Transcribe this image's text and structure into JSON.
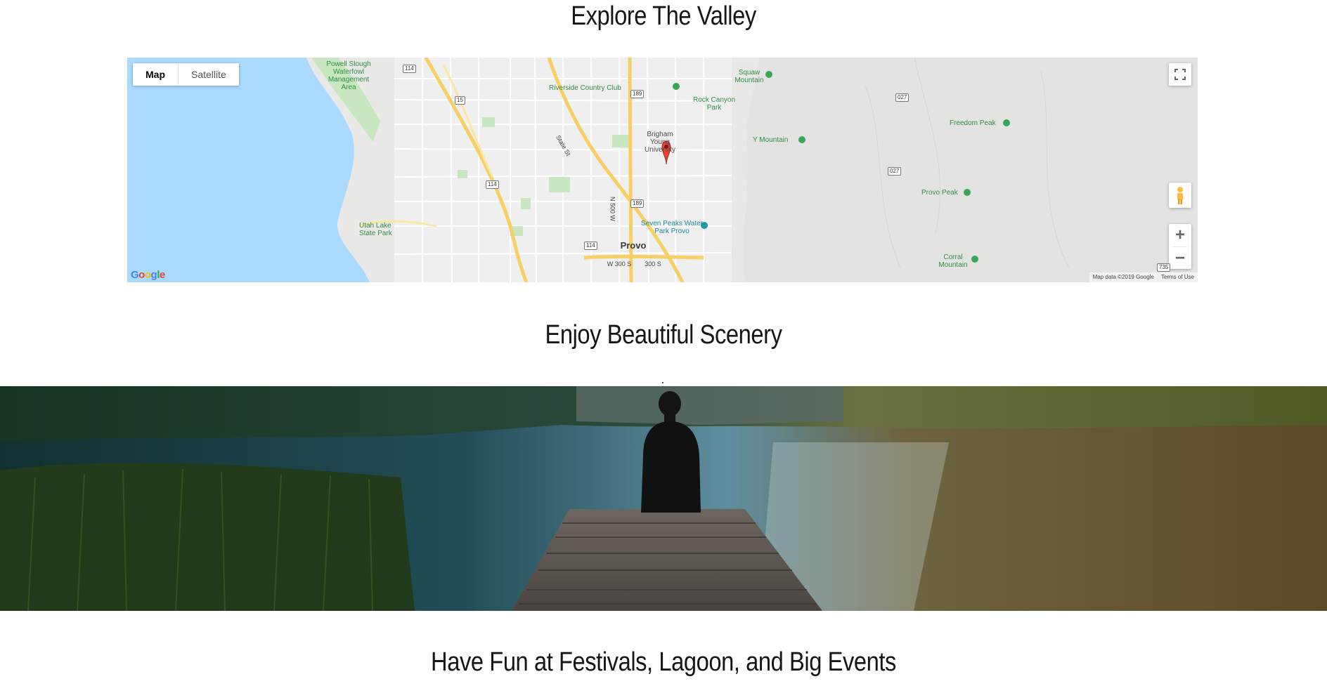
{
  "sections": {
    "explore_title": "Explore The Valley",
    "scenery_title": "Enjoy Beautiful Scenery",
    "fun_title": "Have Fun at Festivals, Lagoon, and Big Events"
  },
  "map": {
    "type_controls": {
      "map_label": "Map",
      "satellite_label": "Satellite"
    },
    "labels": {
      "powell_slough": "Powell Slough Waterfowl Management Area",
      "riverside": "Riverside Country Club",
      "squaw": "Squaw Mountain",
      "rock_canyon": "Rock Canyon Park",
      "byu": "Brigham Young University",
      "y_mountain": "Y Mountain",
      "freedom_peak": "Freedom Peak",
      "provo_peak": "Provo Peak",
      "seven_peaks": "Seven Peaks Water Park Provo",
      "utah_lake": "Utah Lake State Park",
      "provo": "Provo",
      "corral": "Corral Mountain",
      "w300s": "W 300 S",
      "s300": "300 S",
      "state_st": "State St",
      "n500w": "N 500 W"
    },
    "route_shields": [
      "114",
      "15",
      "189",
      "189",
      "114",
      "114",
      "027",
      "027",
      "735"
    ],
    "attribution": "Map data ©2019 Google",
    "terms": "Terms of Use",
    "logo": "Google",
    "icons": {
      "fullscreen": "fullscreen-icon",
      "pegman": "pegman-icon",
      "zoom_in": "plus-icon",
      "zoom_out": "minus-icon",
      "pin": "map-pin-icon"
    }
  },
  "colors": {
    "water": "#aadaff",
    "land": "#e8e8e6",
    "park": "#c8e6c0",
    "highway": "#f6cf65",
    "pin": "#ea4335"
  }
}
